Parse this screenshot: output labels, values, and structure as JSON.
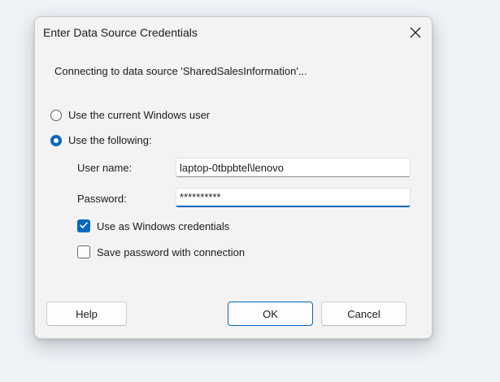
{
  "dialog": {
    "title": "Enter Data Source Credentials",
    "message": "Connecting to data source 'SharedSalesInformation'..."
  },
  "options": {
    "current_user_label": "Use the current Windows user",
    "current_user_selected": false,
    "following_label": "Use the following:",
    "following_selected": true
  },
  "fields": {
    "username_label": "User name:",
    "username_value": "laptop-0tbpbtel\\lenovo",
    "password_label": "Password:",
    "password_value": "**********"
  },
  "checkboxes": {
    "windows_credentials_label": "Use as Windows credentials",
    "windows_credentials_checked": true,
    "save_password_label": "Save password with connection",
    "save_password_checked": false
  },
  "buttons": {
    "help_label": "Help",
    "ok_label": "OK",
    "cancel_label": "Cancel"
  },
  "colors": {
    "accent": "#0067c0",
    "dialog_bg": "#f3f3f3",
    "backdrop": "#eef3f8"
  },
  "icons": {
    "close": "close-icon",
    "check": "checkmark-icon"
  }
}
